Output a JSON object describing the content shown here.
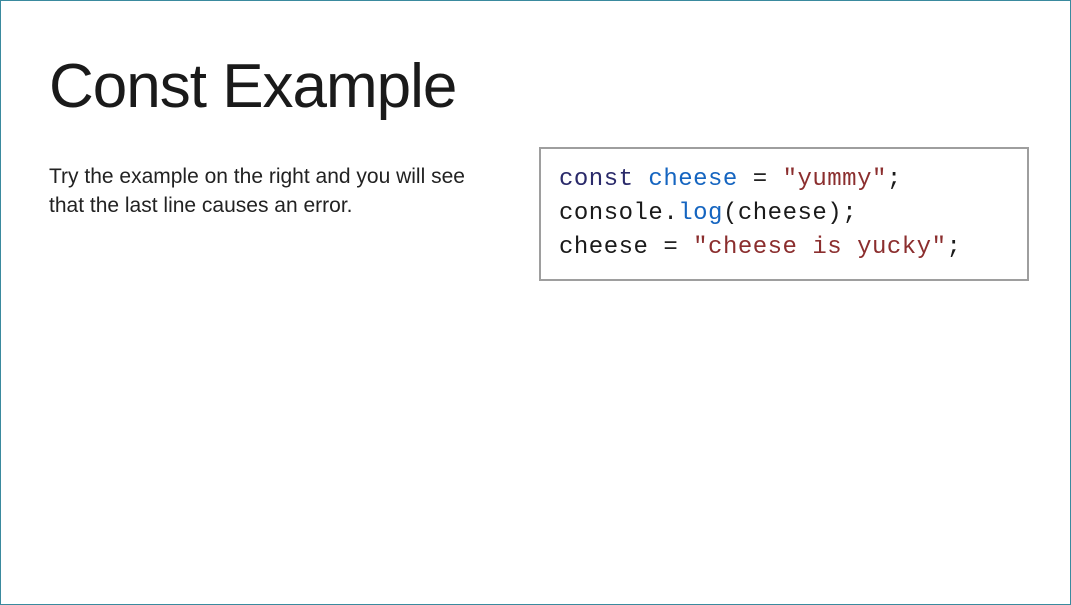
{
  "slide": {
    "title": "Const Example",
    "description": "Try the example on the right and you will see that the last line causes an error.",
    "code": {
      "line1": {
        "kw": "const",
        "ident": "cheese",
        "assign": " = ",
        "str": "\"yummy\"",
        "end": ";"
      },
      "line2": {
        "obj": "console",
        "dot": ".",
        "func": "log",
        "open": "(",
        "arg": "cheese",
        "close": ")",
        "end": ";"
      },
      "line3": {
        "ident": "cheese",
        "assign": " = ",
        "str": "\"cheese is yucky\"",
        "end": ";"
      }
    }
  }
}
